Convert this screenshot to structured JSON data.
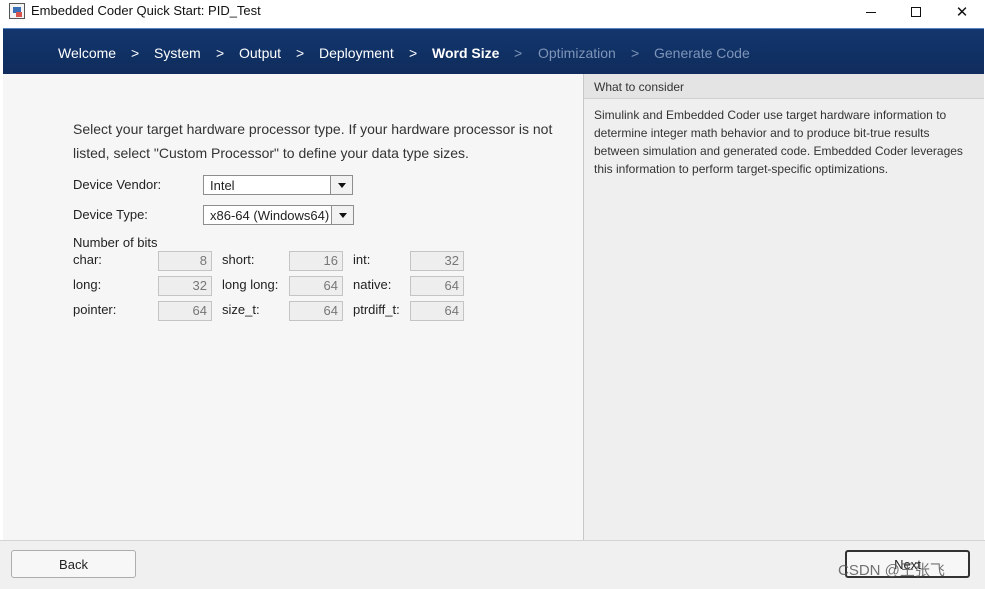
{
  "window": {
    "title": "Embedded Coder Quick Start: PID_Test",
    "app_icon": "simulink-app-icon",
    "controls": {
      "minimize": "minimize-icon",
      "maximize": "maximize-icon",
      "close": "✕"
    }
  },
  "nav": {
    "separator": ">",
    "steps": [
      {
        "label": "Welcome",
        "state": "done"
      },
      {
        "label": "System",
        "state": "done"
      },
      {
        "label": "Output",
        "state": "done"
      },
      {
        "label": "Deployment",
        "state": "done"
      },
      {
        "label": "Word Size",
        "state": "current"
      },
      {
        "label": "Optimization",
        "state": "future"
      },
      {
        "label": "Generate Code",
        "state": "future"
      }
    ]
  },
  "main": {
    "instruction": "Select your target hardware processor type. If your hardware processor is not listed, select \"Custom Processor\" to define your data type sizes.",
    "device_vendor": {
      "label": "Device Vendor:",
      "value": "Intel"
    },
    "device_type": {
      "label": "Device Type:",
      "value": "x86-64 (Windows64)"
    },
    "bits": {
      "title": "Number of bits",
      "fields": [
        {
          "label": "char:",
          "value": "8"
        },
        {
          "label": "short:",
          "value": "16"
        },
        {
          "label": "int:",
          "value": "32"
        },
        {
          "label": "long:",
          "value": "32"
        },
        {
          "label": "long long:",
          "value": "64"
        },
        {
          "label": "native:",
          "value": "64"
        },
        {
          "label": "pointer:",
          "value": "64"
        },
        {
          "label": "size_t:",
          "value": "64"
        },
        {
          "label": "ptrdiff_t:",
          "value": "64"
        }
      ]
    }
  },
  "consider": {
    "title": "What to consider",
    "text": "Simulink and Embedded Coder use target hardware information to determine integer math behavior and to produce bit-true results between simulation and generated code. Embedded Coder leverages this information to perform target-specific optimizations."
  },
  "footer": {
    "back_label": "Back",
    "next_label": "Next",
    "watermark": "CSDN @王张飞"
  },
  "colors": {
    "nav_background": "#12366e",
    "nav_future_text": "#7e94b8",
    "pane_background": "#f6f6f6"
  }
}
